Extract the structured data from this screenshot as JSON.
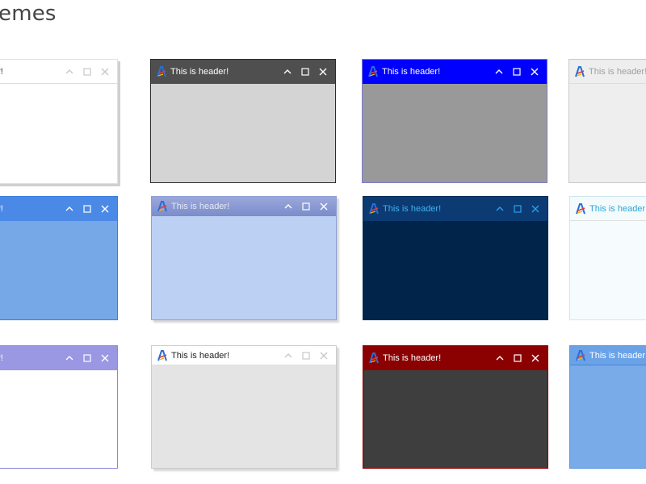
{
  "page": {
    "title": "emes"
  },
  "windows": [
    {
      "title": "er!",
      "header_bg": "#ffffff",
      "header_fg": "#333333",
      "btn_color": "#c8c8c8",
      "body_bg": "#ffffff",
      "border": "#e0e0e0",
      "show_logo": false
    },
    {
      "title": "This is header!",
      "header_bg": "#4f4f4f",
      "header_fg": "#ffffff",
      "btn_color": "#ffffff",
      "body_bg": "#d4d4d4",
      "border": "#2b2b2b",
      "show_logo": true
    },
    {
      "title": "This is header!",
      "header_bg": "#0000ff",
      "header_fg": "#ffffff",
      "btn_color": "#ffffff",
      "body_bg": "#999999",
      "border": "#7a7acc",
      "show_logo": true
    },
    {
      "title": "This is header!",
      "header_bg": "#eeeeee",
      "header_fg": "#a0a0a0",
      "btn_color": "#a0a0a0",
      "body_bg": "#eeeeee",
      "border": "#c9c9c9",
      "show_logo": true
    },
    {
      "title": "er!",
      "header_bg": "#4a8ae6",
      "header_fg": "#ffffff",
      "btn_color": "#ffffff",
      "body_bg": "#76a8e8",
      "border": "#3b7de0",
      "show_logo": false
    },
    {
      "title": "This is header!",
      "header_bg": "#8a9bd2",
      "header_fg": "#e6e9f5",
      "btn_color": "#ffffff",
      "body_bg": "#bcd0f4",
      "border": "#8f9fd6",
      "show_logo": true
    },
    {
      "title": "This is header!",
      "header_bg": "#0c3a73",
      "header_fg": "#3fb3f0",
      "btn_color": "#2aa0e8",
      "body_bg": "#00244a",
      "border": "#002c5a",
      "show_logo": true
    },
    {
      "title": "This is header!",
      "header_bg": "#f4fbfd",
      "header_fg": "#2ba6d6",
      "btn_color": "#2ba6d6",
      "body_bg": "#f6fbfd",
      "border": "#cfe6ef",
      "show_logo": true
    },
    {
      "title": "er!",
      "header_bg": "#9a97e3",
      "header_fg": "#ffffff",
      "btn_color": "#ffffff",
      "body_bg": "#ffffff",
      "border": "#8a87dd",
      "show_logo": false
    },
    {
      "title": "This is header!",
      "header_bg": "#ffffff",
      "header_fg": "#222222",
      "btn_color": "#c8c8c8",
      "body_bg": "#e4e4e4",
      "border": "#cccccc",
      "show_logo": true
    },
    {
      "title": "This is header!",
      "header_bg": "#8b0000",
      "header_fg": "#ffffff",
      "btn_color": "#ffffff",
      "body_bg": "#3e3e3e",
      "border": "#8b0000",
      "show_logo": true
    },
    {
      "title": "This is header!",
      "header_bg": "#6aa2e8",
      "header_fg": "#ffffff",
      "btn_color": "#ffffff",
      "body_bg": "#79abe8",
      "border": "#5b94e0",
      "show_logo": true
    }
  ]
}
